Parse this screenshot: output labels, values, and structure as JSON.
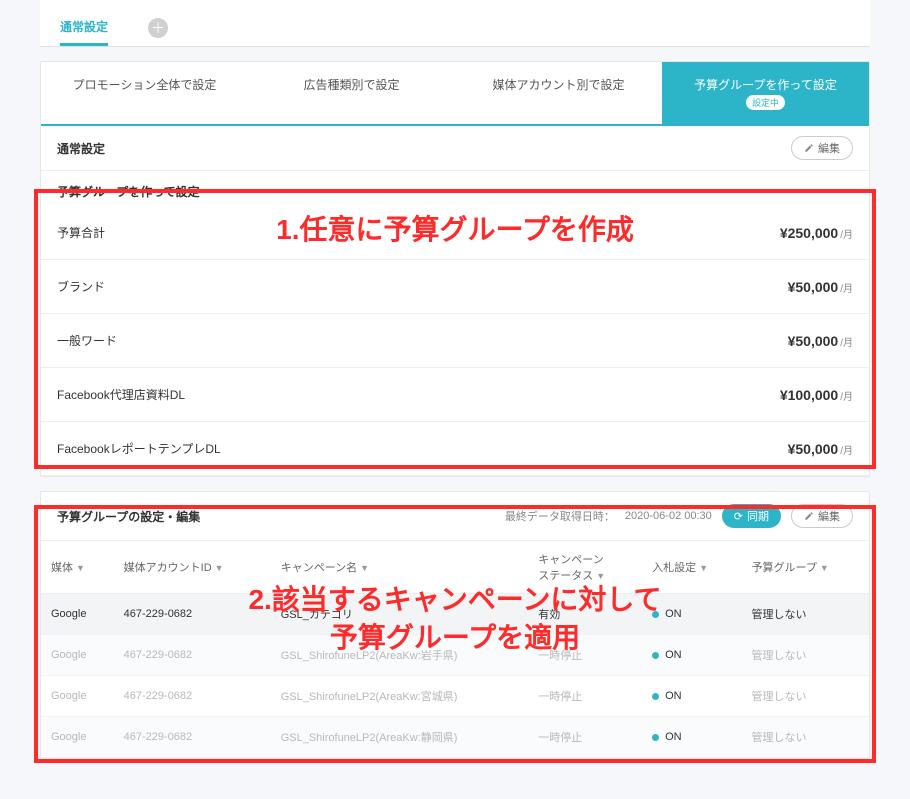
{
  "top_tabs": {
    "active": "通常設定"
  },
  "sub_tabs": {
    "t1": "プロモーション全体で設定",
    "t2": "広告種類別で設定",
    "t3": "媒体アカウント別で設定",
    "t4": "予算グループを作って設定",
    "t4_badge": "設定中"
  },
  "section1": {
    "title": "通常設定",
    "edit": "編集",
    "group_header": "予算グループを作って設定",
    "rows": [
      {
        "name": "予算合計",
        "amount": "¥250,000",
        "per": "/月"
      },
      {
        "name": "ブランド",
        "amount": "¥50,000",
        "per": "/月"
      },
      {
        "name": "一般ワード",
        "amount": "¥50,000",
        "per": "/月"
      },
      {
        "name": "Facebook代理店資料DL",
        "amount": "¥100,000",
        "per": "/月"
      },
      {
        "name": "FacebookレポートテンプレDL",
        "amount": "¥50,000",
        "per": "/月"
      }
    ]
  },
  "annotations": {
    "a1": "1.任意に予算グループを作成",
    "a2": "2.該当するキャンペーンに対して\n予算グループを適用"
  },
  "section2": {
    "title": "予算グループの設定・編集",
    "last_sync_label": "最終データ取得日時：",
    "last_sync_value": "2020-06-02 00:30",
    "sync_btn": "同期",
    "edit": "編集",
    "columns": {
      "media": "媒体",
      "account_id": "媒体アカウントID",
      "campaign_name": "キャンペーン名",
      "campaign_status": "キャンペーン\nステータス",
      "bid_setting": "入札設定",
      "budget_group": "予算グループ"
    },
    "rows": [
      {
        "media": "Google",
        "account": "467-229-0682",
        "name": "GSL_カテゴリ",
        "status": "有効",
        "bid": "ON",
        "group": "管理しない",
        "current": true
      },
      {
        "media": "Google",
        "account": "467-229-0682",
        "name": "GSL_ShirofuneLP2(AreaKw:岩手県)",
        "status": "一時停止",
        "bid": "ON",
        "group": "管理しない",
        "current": false
      },
      {
        "media": "Google",
        "account": "467-229-0682",
        "name": "GSL_ShirofuneLP2(AreaKw:宮城県)",
        "status": "一時停止",
        "bid": "ON",
        "group": "管理しない",
        "current": false
      },
      {
        "media": "Google",
        "account": "467-229-0682",
        "name": "GSL_ShirofuneLP2(AreaKw:静岡県)",
        "status": "一時停止",
        "bid": "ON",
        "group": "管理しない",
        "current": false
      }
    ]
  }
}
